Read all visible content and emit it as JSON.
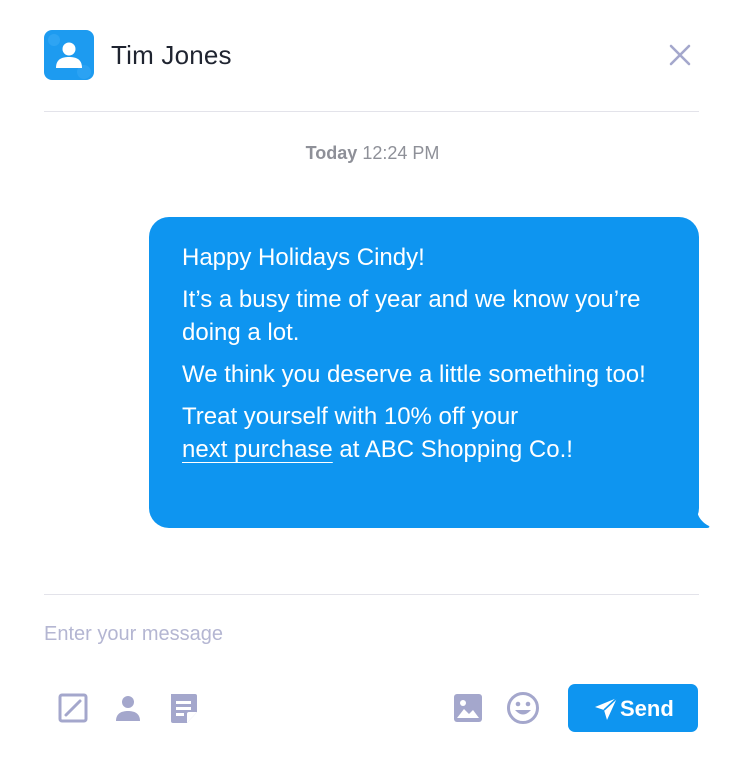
{
  "header": {
    "contact_name": "Tim Jones",
    "icons": {
      "avatar": "person-avatar-icon",
      "close": "close-icon"
    }
  },
  "conversation": {
    "timestamp_day": "Today",
    "timestamp_time": "12:24 PM",
    "message": {
      "line1": "Happy Holidays Cindy!",
      "line2": "It’s a busy time of year and we know you’re doing a lot.",
      "line3": "We think you deserve a little something too!",
      "line4_prefix": "Treat yourself with 10% off your",
      "line4_link": "next purchase",
      "line4_suffix": " at ABC Shopping Co.!"
    }
  },
  "composer": {
    "placeholder": "Enter your message",
    "send_label": "Send",
    "tools_left": [
      "edit-icon",
      "person-icon",
      "note-icon"
    ],
    "tools_right": [
      "image-icon",
      "emoji-icon"
    ]
  },
  "colors": {
    "accent": "#0e95f0",
    "avatar_bg": "#1d9bf0",
    "icon_gray": "#a4a7cc",
    "timestamp": "#8e9098",
    "placeholder": "#b4b6d2"
  }
}
